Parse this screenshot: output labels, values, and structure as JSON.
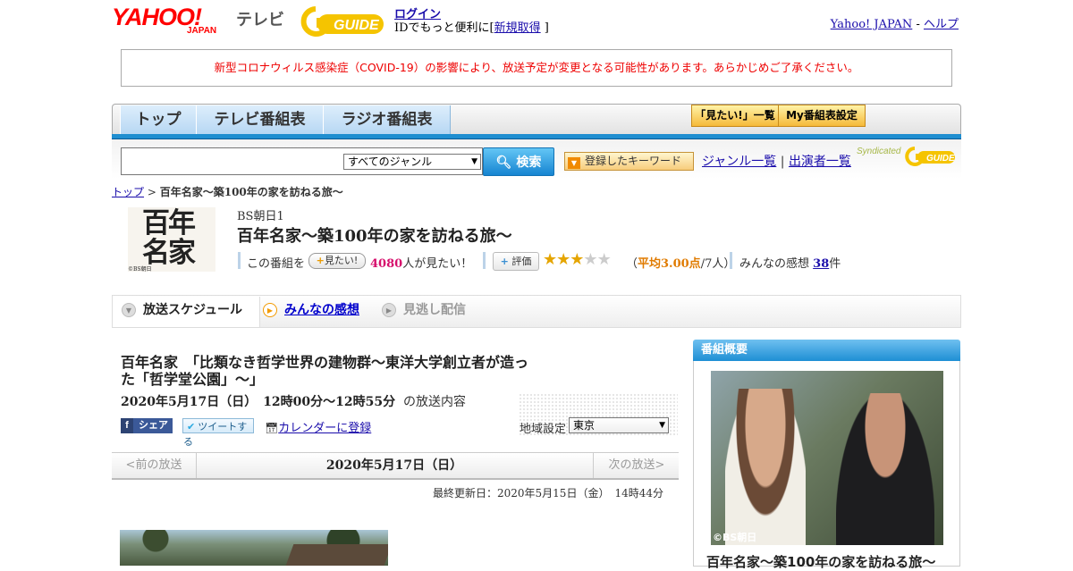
{
  "header": {
    "yahoo_logo": "YAHOO!",
    "yahoo_japan": "JAPAN",
    "tv_label": "テレビ",
    "gguide_logo": "GUIDE",
    "login_label": "ログイン",
    "login_sub_prefix": "IDでもっと便利に[",
    "signup_label": "新規取得",
    "login_sub_suffix": "]",
    "yahoo_japan_link": "Yahoo! JAPAN",
    "separator": "-",
    "help_link": "ヘルプ"
  },
  "notice": "新型コロナウィルス感染症（COVID-19）の影響により、放送予定が変更となる可能性があります。あらかじめご了承ください。",
  "nav": {
    "tabs": [
      {
        "label": "トップ"
      },
      {
        "label": "テレビ番組表"
      },
      {
        "label": "ラジオ番組表"
      }
    ],
    "mitai_list": "「見たい!」一覧",
    "my_settings": "My番組表設定"
  },
  "search": {
    "genre_selected": "すべてのジャンル",
    "button_label": "検索",
    "keyword_button": "登録したキーワード",
    "genre_list_link": "ジャンル一覧",
    "link_separator": "|",
    "performer_list_link": "出演者一覧",
    "syndicated": "Syndicated"
  },
  "breadcrumb": {
    "top": "トップ",
    "sep": ">",
    "current": "百年名家～築100年の家を訪ねる旅～"
  },
  "program": {
    "logo_text_1": "百年",
    "logo_text_2": "名家",
    "logo_copyright": "©BS朝日",
    "channel": "BS朝日1",
    "title": "百年名家～築100年の家を訪ねる旅～",
    "want_prefix": "この番組を",
    "mitai_button": "見たい!",
    "want_count": "4080",
    "want_suffix": "人が見たい！",
    "rate_button": "評価",
    "rating_stars": 3,
    "avg_prefix": "（",
    "avg_label": "平均3.00点",
    "avg_suffix": "/7人）",
    "impressions_prefix": "みんなの感想",
    "impressions_count": "38",
    "impressions_suffix": "件"
  },
  "tabs": {
    "schedule": "放送スケジュール",
    "kansou": "みんなの感想",
    "minogashi": "見逃し配信"
  },
  "episode": {
    "title": "百年名家　「比類なき哲学世界の建物群～東洋大学創立者が造った「哲学堂公園」～」",
    "datetime": "2020年5月17日（日）　12時00分～12時55分",
    "datetime_suffix": "の放送内容",
    "share_label": "シェア",
    "tweet_label": "ツイートする",
    "calendar_link": "カレンダーに登録",
    "region_label": "地域設定",
    "region_value": "東京",
    "prev_label": "<前の放送",
    "date_label": "2020年5月17日（日）",
    "next_label": "次の放送>",
    "updated": "最終更新日：2020年5月15日（金）　14時44分"
  },
  "sidebar": {
    "header": "番組概要",
    "photo_credit": "©BS朝日",
    "title": "百年名家～築100年の家を訪ねる旅～"
  },
  "colors": {
    "accent_blue": "#1f8ed0",
    "yahoo_red": "#ff0000",
    "notice_red": "#e00000",
    "want_pink": "#d60f6c",
    "star_gold": "#e5a500"
  }
}
